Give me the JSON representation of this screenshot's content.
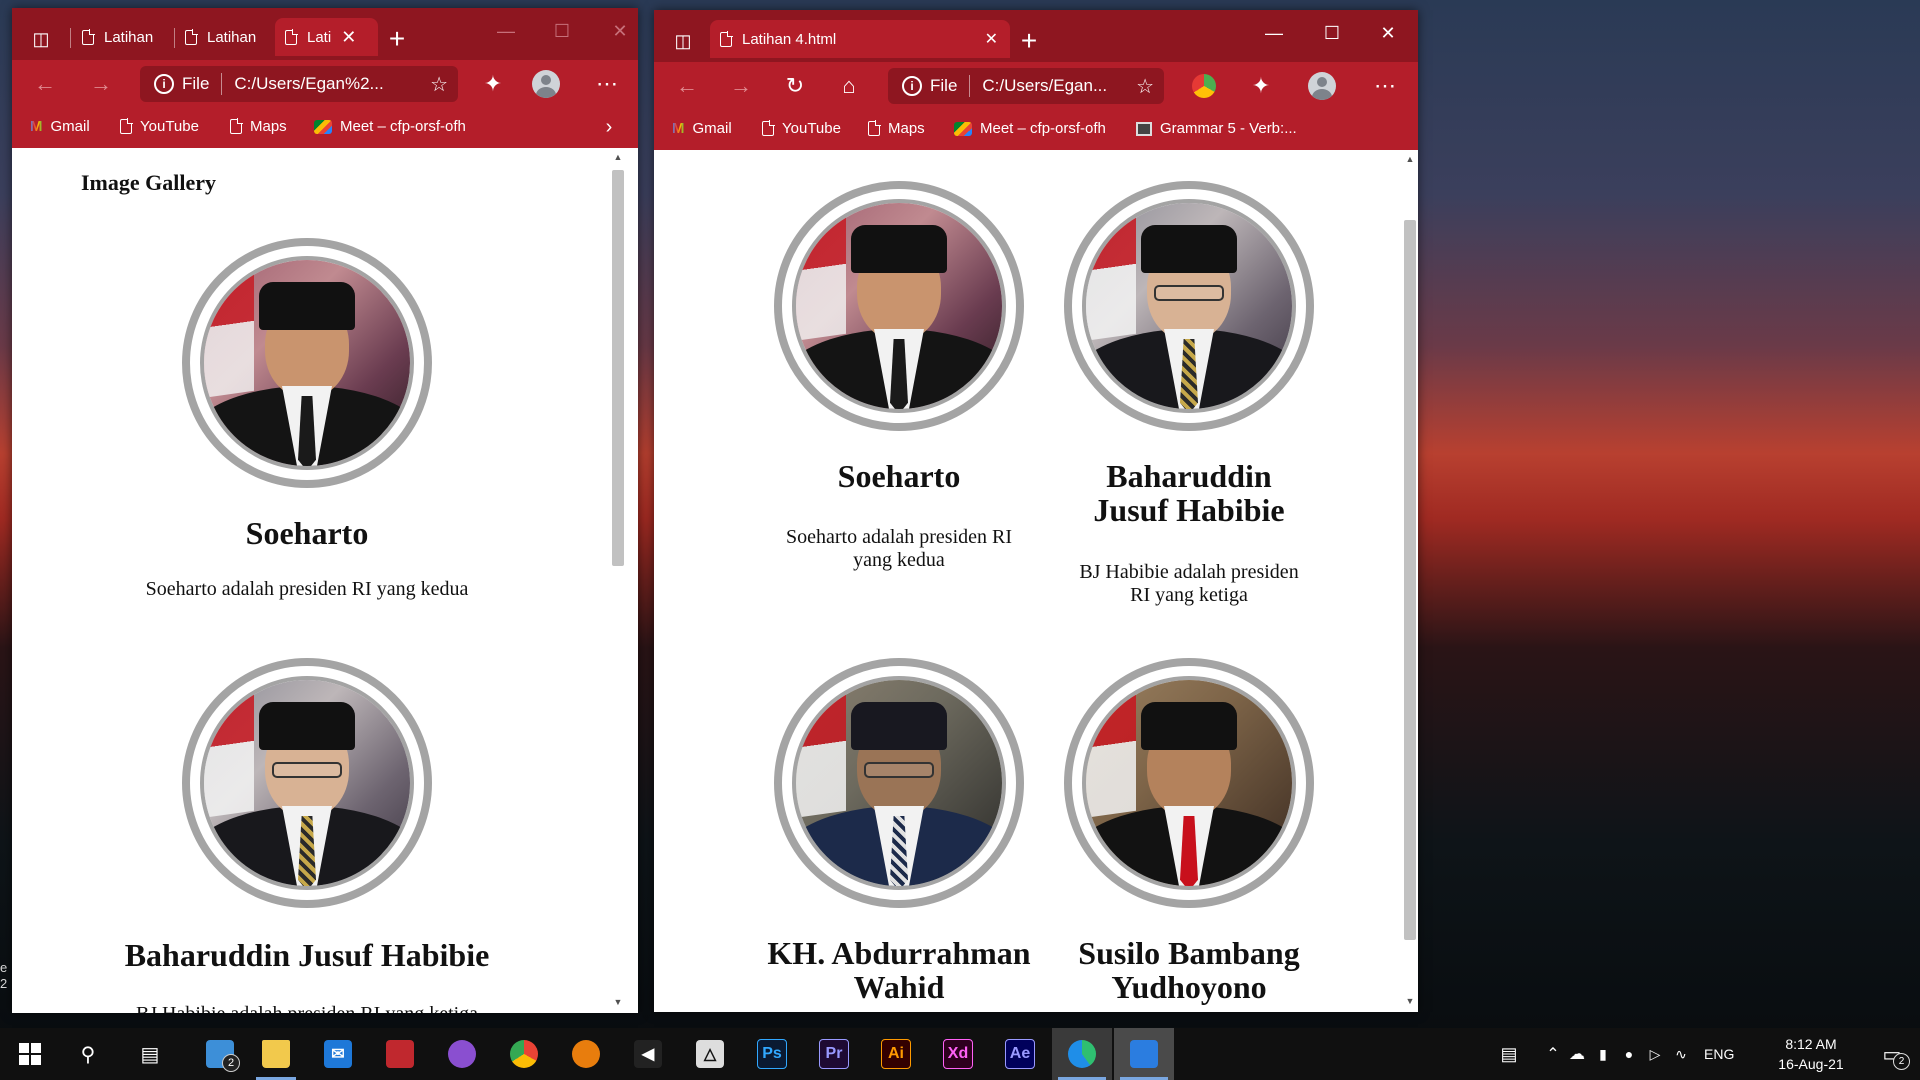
{
  "desktop": {
    "edge_text": "e\n2"
  },
  "left_window": {
    "tabs": [
      {
        "label": "Latihan"
      },
      {
        "label": "Latihan"
      },
      {
        "label": "Lati"
      }
    ],
    "address": {
      "scheme": "File",
      "url": "C:/Users/Egan%2..."
    },
    "favorites": [
      {
        "label": "Gmail",
        "icon": "gmail-icon"
      },
      {
        "label": "YouTube",
        "icon": "page-icon"
      },
      {
        "label": "Maps",
        "icon": "page-icon"
      },
      {
        "label": "Meet – cfp-orsf-ofh",
        "icon": "meet-icon"
      }
    ],
    "page": {
      "heading": "Image Gallery",
      "cards": [
        {
          "name": "Soeharto",
          "desc": "Soeharto adalah presiden RI yang kedua"
        },
        {
          "name": "Baharuddin Jusuf Habibie",
          "desc": "BJ Habibie adalah presiden RI yang ketiga"
        }
      ]
    }
  },
  "right_window": {
    "tabs": [
      {
        "label": "Latihan 4.html"
      }
    ],
    "address": {
      "scheme": "File",
      "url": "C:/Users/Egan..."
    },
    "favorites": [
      {
        "label": "Gmail",
        "icon": "gmail-icon"
      },
      {
        "label": "YouTube",
        "icon": "page-icon"
      },
      {
        "label": "Maps",
        "icon": "page-icon"
      },
      {
        "label": "Meet – cfp-orsf-ofh",
        "icon": "meet-icon"
      },
      {
        "label": "Grammar 5 - Verb:...",
        "icon": "grammar-icon"
      }
    ],
    "page": {
      "cards": [
        {
          "name": "Soeharto",
          "desc": "Soeharto adalah presiden RI yang kedua"
        },
        {
          "name": "Baharuddin Jusuf Habibie",
          "desc": "BJ Habibie adalah presiden RI yang ketiga"
        },
        {
          "name": "KH. Abdurrahman Wahid",
          "desc": ""
        },
        {
          "name": "Susilo Bambang Yudhoyono",
          "desc": ""
        }
      ]
    }
  },
  "taskbar": {
    "apps": [
      {
        "name": "start-icon"
      },
      {
        "name": "search-icon"
      },
      {
        "name": "task-view-icon"
      },
      {
        "name": "file-manager-icon",
        "badge": "2"
      },
      {
        "name": "file-explorer-icon"
      },
      {
        "name": "mail-icon"
      },
      {
        "name": "game-icon"
      },
      {
        "name": "github-icon"
      },
      {
        "name": "chrome-icon"
      },
      {
        "name": "blender-icon"
      },
      {
        "name": "visual-studio-icon"
      },
      {
        "name": "unity-icon"
      },
      {
        "name": "photoshop-icon",
        "label": "Ps"
      },
      {
        "name": "premiere-icon",
        "label": "Pr"
      },
      {
        "name": "illustrator-icon",
        "label": "Ai"
      },
      {
        "name": "xd-icon",
        "label": "Xd"
      },
      {
        "name": "after-effects-icon",
        "label": "Ae"
      },
      {
        "name": "edge-icon"
      },
      {
        "name": "vscode-icon"
      }
    ],
    "language": "ENG",
    "time": "8:12 AM",
    "date": "16-Aug-21",
    "notification_count": "2"
  }
}
